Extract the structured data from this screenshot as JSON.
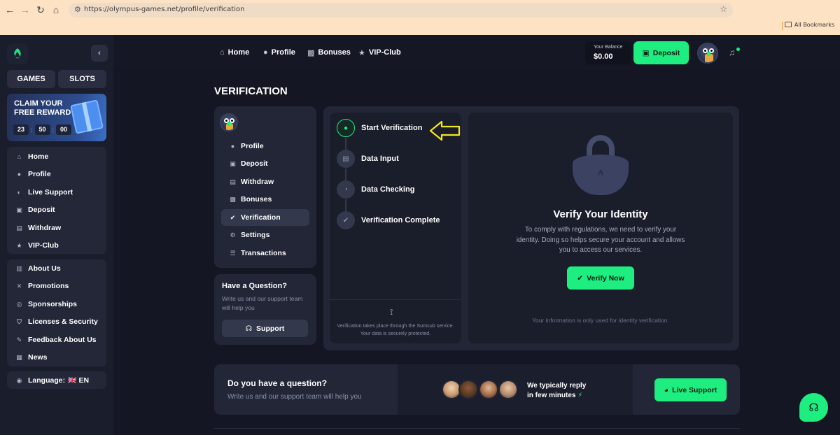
{
  "browser": {
    "url": "https://olympus-games.net/profile/verification",
    "bookmarks_label": "All Bookmarks"
  },
  "sidebar": {
    "tab_games": "GAMES",
    "tab_slots": "SLOTS",
    "promo": {
      "title": "CLAIM YOUR FREE REWARD",
      "timer": [
        "23",
        "50",
        "00"
      ]
    },
    "main_items": [
      {
        "label": "Home",
        "icon": "home-icon"
      },
      {
        "label": "Profile",
        "icon": "user-icon"
      },
      {
        "label": "Live Support",
        "icon": "support-icon"
      },
      {
        "label": "Deposit",
        "icon": "wallet-icon"
      },
      {
        "label": "Withdraw",
        "icon": "withdraw-icon"
      },
      {
        "label": "VIP-Club",
        "icon": "star-icon"
      }
    ],
    "info_items": [
      {
        "label": "About Us",
        "icon": "book-icon"
      },
      {
        "label": "Promotions",
        "icon": "promo-icon"
      },
      {
        "label": "Sponsorships",
        "icon": "medal-icon"
      },
      {
        "label": "Licenses & Security",
        "icon": "shield-icon"
      },
      {
        "label": "Feedback About Us",
        "icon": "feedback-icon"
      },
      {
        "label": "News",
        "icon": "news-icon"
      }
    ],
    "language_label": "Language:",
    "language_flag": "🇬🇧",
    "language_code": "EN"
  },
  "header": {
    "nav": [
      {
        "label": "Home",
        "icon": "home-icon"
      },
      {
        "label": "Profile",
        "icon": "user-icon"
      },
      {
        "label": "Bonuses",
        "icon": "gift-icon"
      },
      {
        "label": "VIP-Club",
        "icon": "star-icon"
      }
    ],
    "balance_label": "Your Balance",
    "balance_value": "$0.00",
    "deposit_label": "Deposit"
  },
  "page": {
    "title": "VERIFICATION"
  },
  "profile_menu": [
    {
      "label": "Profile",
      "icon": "user-icon",
      "active": false
    },
    {
      "label": "Deposit",
      "icon": "wallet-icon",
      "active": false
    },
    {
      "label": "Withdraw",
      "icon": "withdraw-icon",
      "active": false
    },
    {
      "label": "Bonuses",
      "icon": "gift-icon",
      "active": false
    },
    {
      "label": "Verification",
      "icon": "check-badge-icon",
      "active": true
    },
    {
      "label": "Settings",
      "icon": "gear-icon",
      "active": false
    },
    {
      "label": "Transactions",
      "icon": "list-icon",
      "active": false
    }
  ],
  "question_card": {
    "title": "Have a Question?",
    "text": "Write us and our support team will help you",
    "button": "Support"
  },
  "steps": [
    {
      "label": "Start Verification",
      "active": true
    },
    {
      "label": "Data Input",
      "active": false
    },
    {
      "label": "Data Checking",
      "active": false
    },
    {
      "label": "Verification Complete",
      "active": false
    }
  ],
  "steps_footer": "Verification takes place through the Sumsub service. Your data is securely protected.",
  "verify": {
    "title": "Verify Your Identity",
    "description": "To comply with regulations, we need to verify your identity. Doing so helps secure your account and allows you to access our services.",
    "button": "Verify Now",
    "note": "Your information is only used for identity verification."
  },
  "bottom": {
    "title": "Do you have a question?",
    "subtitle": "Write us and our support team will help you",
    "reply_line1": "We typically reply",
    "reply_line2": "in few minutes",
    "button": "Live Support"
  },
  "colors": {
    "accent": "#1dee7f",
    "background": "#151824",
    "card": "#222637",
    "annotation_arrow": "#f4e81a"
  }
}
